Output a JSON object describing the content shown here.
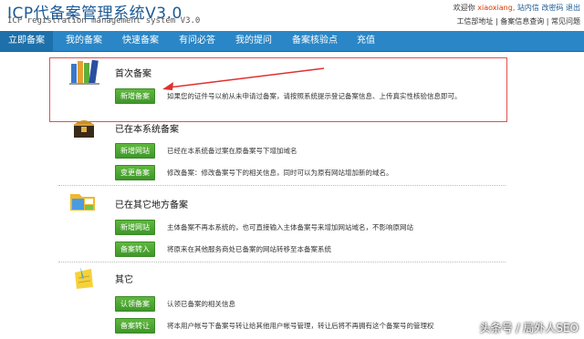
{
  "header": {
    "logo_title": "ICP代备案管理系统V3.0",
    "logo_subtitle": "ICP registration management system V3.0",
    "welcome": "欢迎你",
    "username": "xiaoxiang,",
    "inbox": "站内信",
    "change_password": "改密码",
    "logout": "退出",
    "links": [
      "工信部地址",
      "备案信息查询",
      "常见问题"
    ]
  },
  "nav": {
    "items": [
      "立即备案",
      "我的备案",
      "快速备案",
      "有问必答",
      "我的提问",
      "备案核验点",
      "充值"
    ]
  },
  "sections": [
    {
      "title": "首次备案",
      "icon": "books-icon",
      "rows": [
        {
          "button": "新增备案",
          "text": "如果您的证件号以前从未申请过备案，请按照系统提示登记备案信息、上传真实性核验信息即可。"
        }
      ]
    },
    {
      "title": "已在本系统备案",
      "icon": "treasure-chest-icon",
      "rows": [
        {
          "button": "新增网站",
          "text": "已经在本系统备过案在原备案号下增加域名"
        },
        {
          "button": "变更备案",
          "text": "修改备案：修改备案号下的相关信息，同时可以为原有网站增加新的域名。"
        }
      ]
    },
    {
      "title": "已在其它地方备案",
      "icon": "folder-icon",
      "rows": [
        {
          "button": "新增网站",
          "text": "主体备案不再本系统的，也可直接输入主体备案号来增加网站域名，不影响原网站"
        },
        {
          "button": "备案转入",
          "text": "将原来在其他服务商处已备案的网站转移至本备案系统"
        }
      ]
    },
    {
      "title": "其它",
      "icon": "notepad-icon",
      "rows": [
        {
          "button": "认领备案",
          "text": "认领已备案的相关信息"
        },
        {
          "button": "备案转让",
          "text": "将本用户帐号下备案号转让给其他用户帐号管理，转让后将不再拥有这个备案号的管理权"
        }
      ]
    }
  ],
  "watermark": "头条号 / 局外人SEO",
  "colors": {
    "nav_bg": "#2a86c6",
    "button_green": "#4aa530",
    "highlight_red": "#e05050"
  }
}
